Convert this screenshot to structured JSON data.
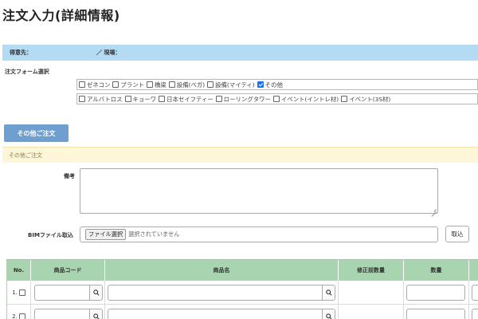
{
  "page": {
    "title": "注文入力(詳細情報)"
  },
  "info_bar": {
    "destination_label": "得意先：",
    "site_label": "／ 現場："
  },
  "form_select": {
    "label": "注文フォーム選択",
    "row1": [
      {
        "label": "ゼネコン",
        "checked": false
      },
      {
        "label": "プラント",
        "checked": false
      },
      {
        "label": "橋梁",
        "checked": false
      },
      {
        "label": "設備(ベガ)",
        "checked": false
      },
      {
        "label": "設備(マイティ)",
        "checked": false
      },
      {
        "label": "その他",
        "checked": true
      }
    ],
    "row2": [
      {
        "label": "アルバトロス",
        "checked": false
      },
      {
        "label": "キョーワ",
        "checked": false
      },
      {
        "label": "日本セイフティー",
        "checked": false
      },
      {
        "label": "ローリングタワー",
        "checked": false
      },
      {
        "label": "イベント(イントレ材)",
        "checked": false
      },
      {
        "label": "イベント(3S材)",
        "checked": false
      }
    ]
  },
  "other_order_button": {
    "label": "その他ご注文"
  },
  "section": {
    "title": "その他ご注文"
  },
  "remarks": {
    "label": "備考",
    "value": ""
  },
  "bim": {
    "label": "BIMファイル取込",
    "file_button": "ファイル選択",
    "file_status": "選択されていません",
    "import_button": "取込"
  },
  "table": {
    "headers": {
      "no": "No.",
      "code": "商品コード",
      "name": "商品名",
      "pre_qty": "修正前数量",
      "qty": "数量"
    },
    "rows": [
      {
        "no": "1."
      },
      {
        "no": "2."
      }
    ]
  },
  "colors": {
    "info_bar": "#b3dcf4",
    "button": "#6f9fd1",
    "section_header": "#fdf6d8",
    "table_header": "#a8d5b0",
    "checkbox_checked": "#1a73e8"
  },
  "icons": {
    "table_search": "search-icon"
  }
}
